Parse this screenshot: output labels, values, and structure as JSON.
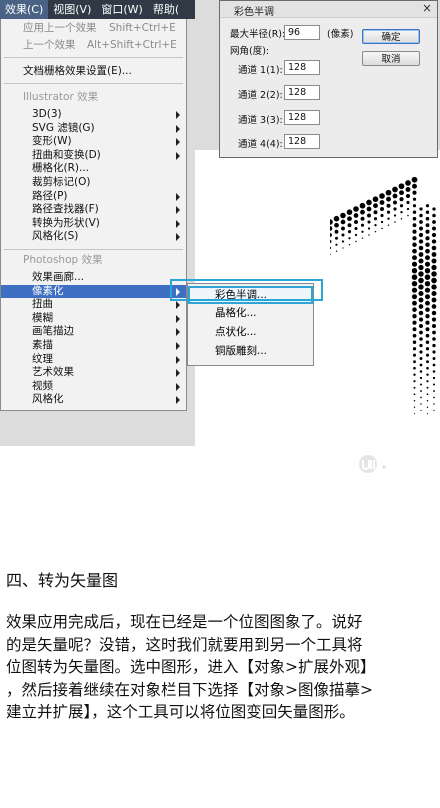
{
  "menubar": [
    {
      "label": "效果(C)",
      "active": true
    },
    {
      "label": "视图(V)",
      "active": false
    },
    {
      "label": "窗口(W)",
      "active": false
    },
    {
      "label": "帮助(",
      "active": false
    }
  ],
  "menu": {
    "apply_last": {
      "label": "应用上一个效果",
      "shortcut": "Shift+Ctrl+E"
    },
    "last": {
      "label": "上一个效果",
      "shortcut": "Alt+Shift+Ctrl+E"
    },
    "raster_settings": "文档栅格效果设置(E)...",
    "illustrator_header": "Illustrator 效果",
    "illustrator_items": [
      "3D(3)",
      "SVG 滤镜(G)",
      "变形(W)",
      "扭曲和变换(D)",
      "栅格化(R)...",
      "裁剪标记(O)",
      "路径(P)",
      "路径查找器(F)",
      "转换为形状(V)",
      "风格化(S)"
    ],
    "photoshop_header": "Photoshop 效果",
    "photoshop_items": [
      "效果画廊...",
      "像素化",
      "扭曲",
      "模糊",
      "画笔描边",
      "素描",
      "纹理",
      "艺术效果",
      "视频",
      "风格化"
    ]
  },
  "submenu": [
    "彩色半调...",
    "晶格化...",
    "点状化...",
    "铜版雕刻..."
  ],
  "dialog": {
    "title": "彩色半调",
    "max_radius_label": "最大半径(R):",
    "max_radius_value": "96",
    "unit": "(像素)",
    "angle_label": "网角(度):",
    "channels": [
      {
        "label": "通道 1(1):",
        "value": "128"
      },
      {
        "label": "通道 2(2):",
        "value": "128"
      },
      {
        "label": "通道 3(3):",
        "value": "128"
      },
      {
        "label": "通道 4(4):",
        "value": "128"
      }
    ],
    "ok": "确定",
    "cancel": "取消"
  },
  "article": {
    "heading": "四、转为矢量图",
    "lines": [
      "效果应用完成后，现在已经是一个位图图象了。说好",
      "的是矢量呢？没错，这时我们就要用到另一个工具将",
      "位图转为矢量图。选中图形，进入【对象>扩展外观】",
      "，然后接着继续在对象栏目下选择【对象>图像描摹>",
      "建立并扩展】，这个工具可以将位图变回矢量图形。"
    ]
  },
  "colors": {
    "highlight": "#3d6fc2",
    "callout": "#27a6d8",
    "menubar": "#2f3a46"
  }
}
